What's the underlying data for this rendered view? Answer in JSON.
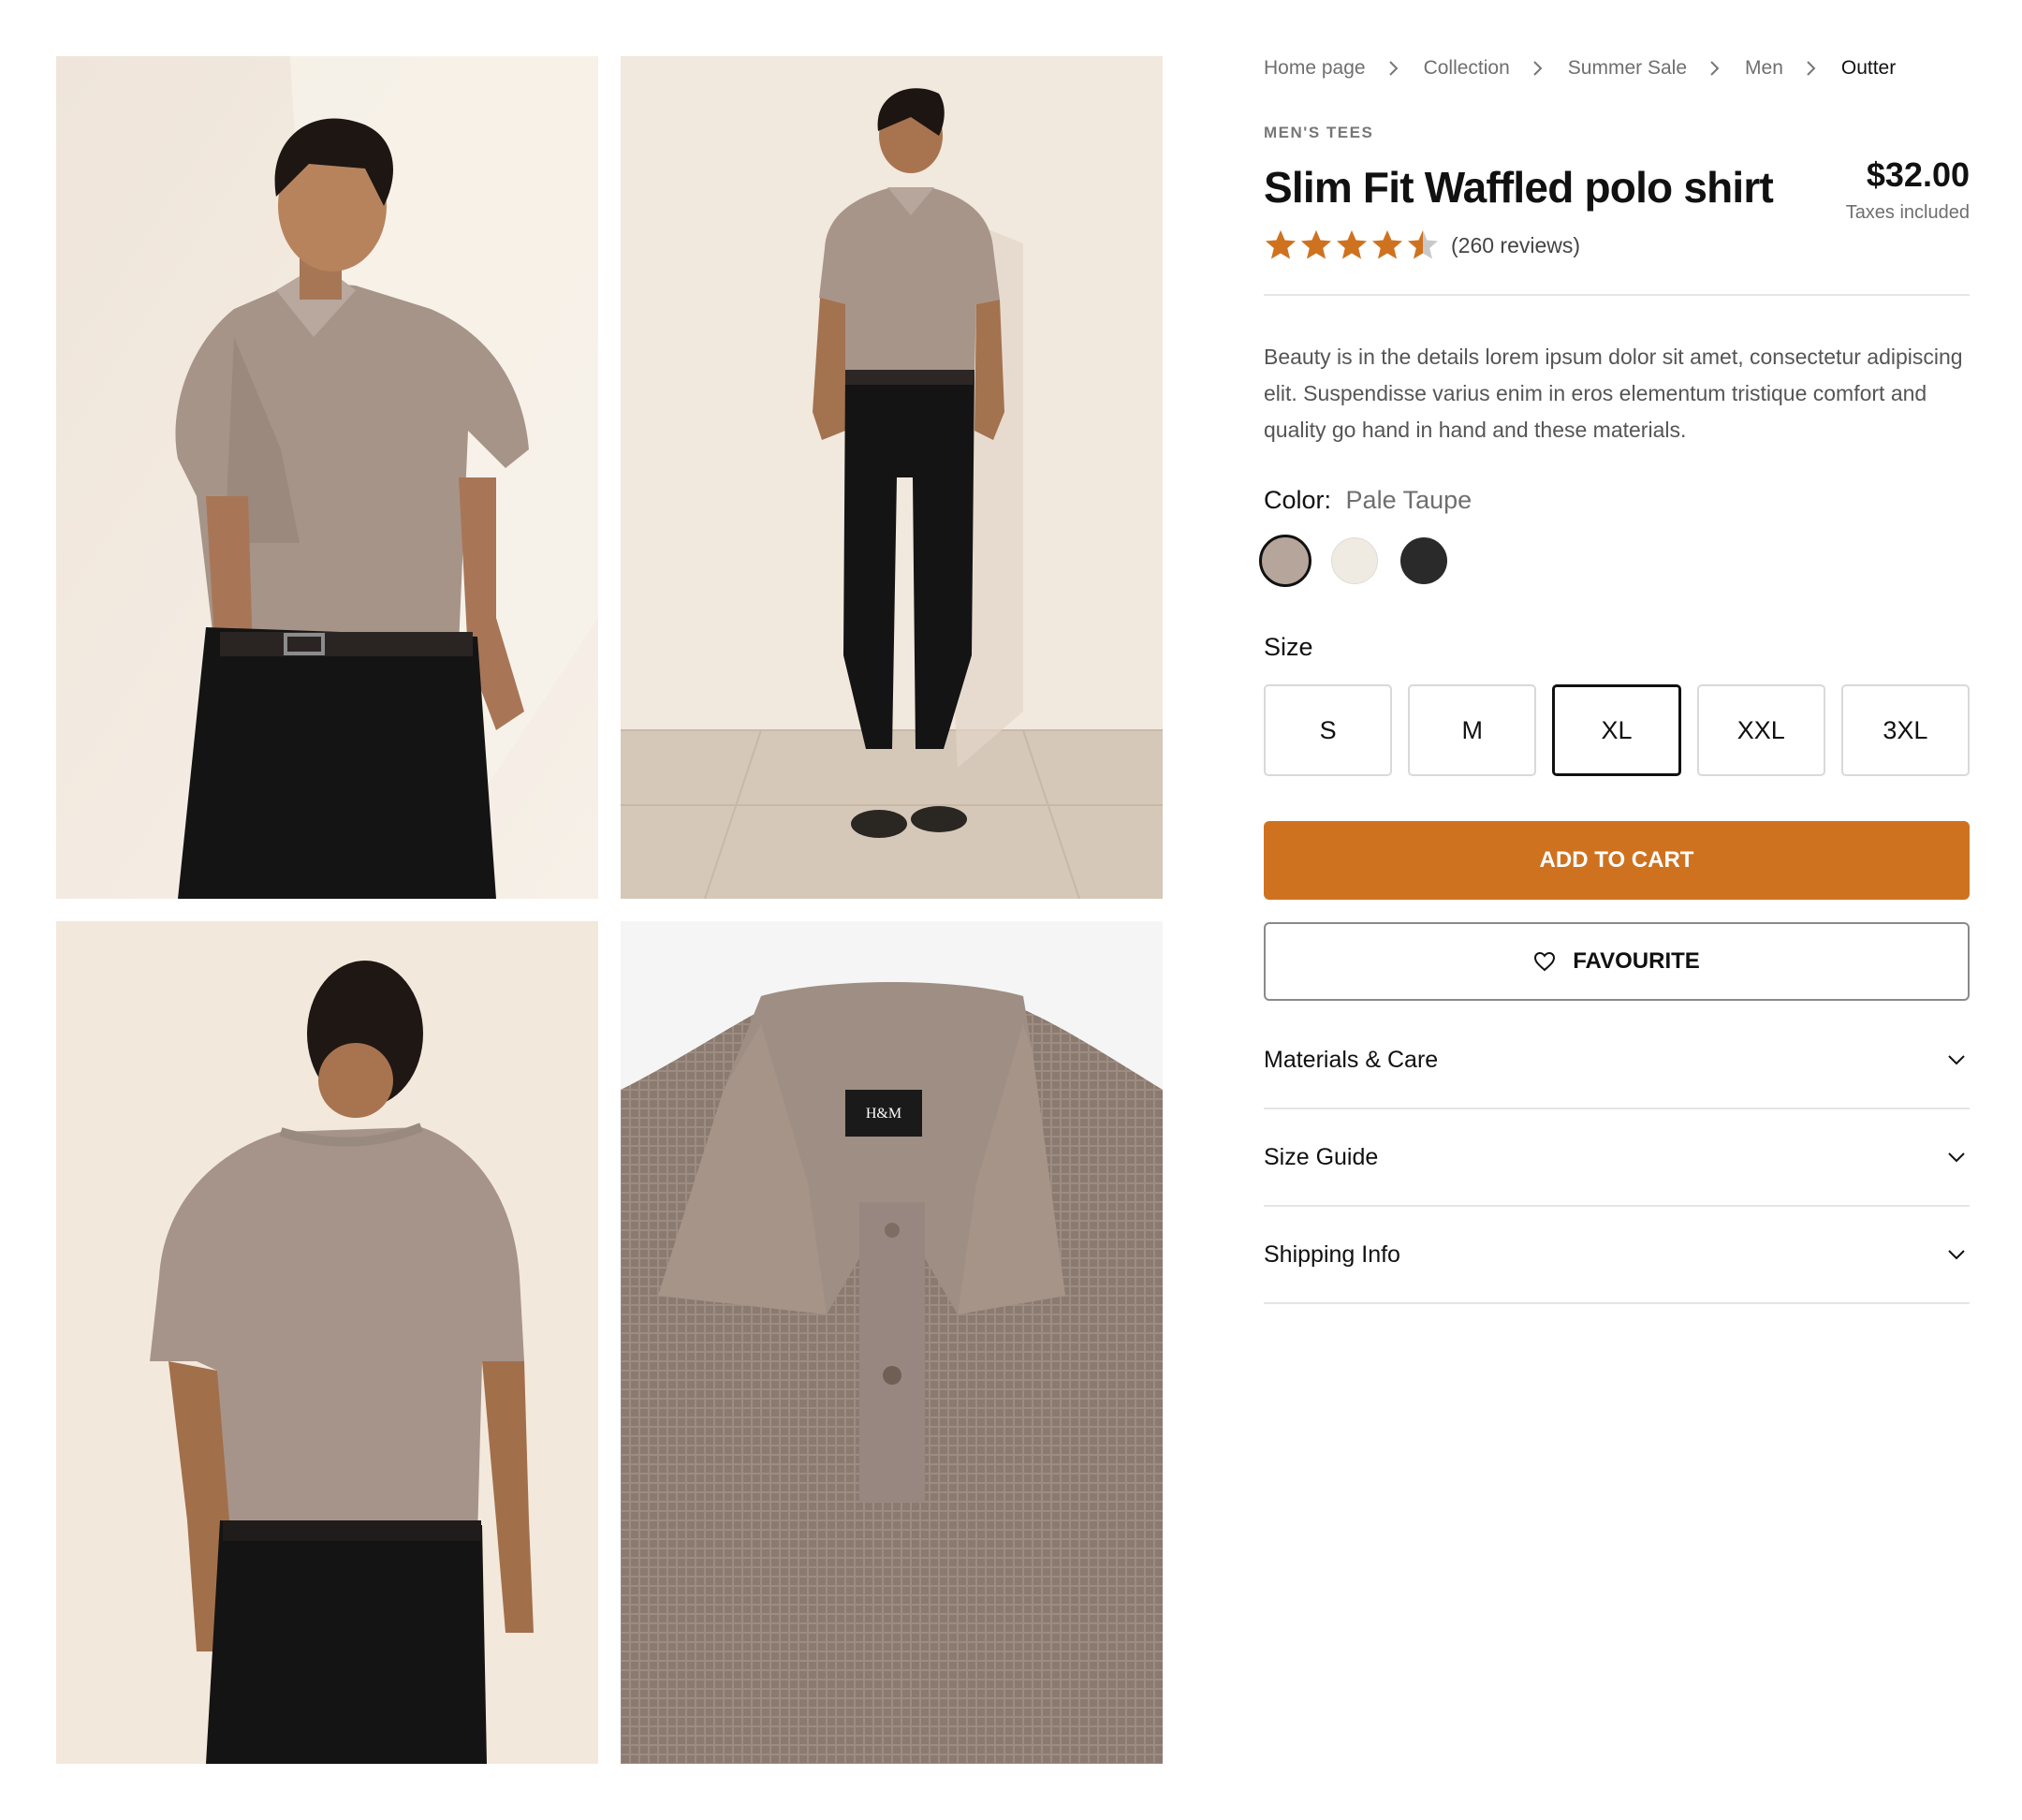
{
  "breadcrumb": [
    "Home page",
    "Collection",
    "Summer Sale",
    "Men",
    "Outter"
  ],
  "product": {
    "category": "MEN'S TEES",
    "title": "Slim Fit Waffled polo shirt",
    "price": "$32.00",
    "tax_note": "Taxes included",
    "rating": 4.5,
    "reviews_label": "(260 reviews)",
    "description": "Beauty is in the details lorem ipsum dolor sit amet, consectetur adipiscing elit. Suspendisse varius enim in eros elementum tristique comfort and quality go hand in hand and these materials."
  },
  "color": {
    "label": "Color:",
    "selected_name": "Pale Taupe",
    "swatches": [
      {
        "name": "pale-taupe",
        "hex": "#b5a59b",
        "selected": true
      },
      {
        "name": "cream",
        "hex": "#efebe3",
        "selected": false
      },
      {
        "name": "black",
        "hex": "#2a2a2a",
        "selected": false
      }
    ]
  },
  "size": {
    "label": "Size",
    "options": [
      "S",
      "M",
      "XL",
      "XXL",
      "3XL"
    ],
    "selected": "XL"
  },
  "actions": {
    "add_to_cart": "ADD TO CART",
    "favourite": "FAVOURITE"
  },
  "accordion": [
    "Materials & Care",
    "Size Guide",
    "Shipping Info"
  ],
  "colors": {
    "accent": "#cf721f",
    "star": "#cf721f",
    "border": "#e5e5e5"
  },
  "gallery": [
    {
      "name": "model-front-closeup"
    },
    {
      "name": "model-full-length"
    },
    {
      "name": "model-back-view"
    },
    {
      "name": "collar-detail"
    }
  ]
}
